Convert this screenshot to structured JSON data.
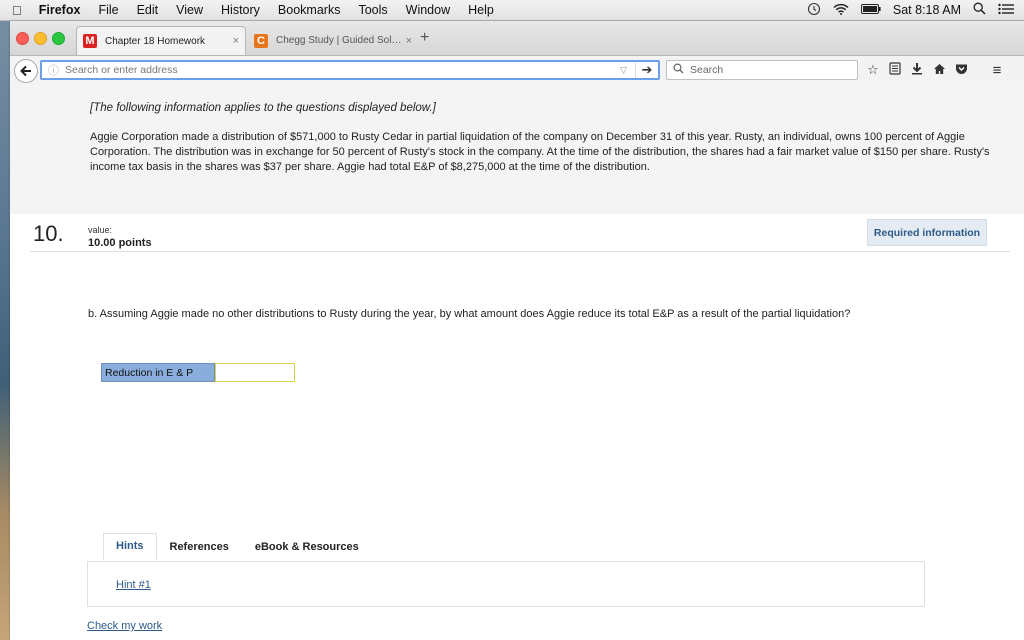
{
  "menubar": {
    "app": "Firefox",
    "items": [
      "File",
      "Edit",
      "View",
      "History",
      "Bookmarks",
      "Tools",
      "Window",
      "Help"
    ],
    "clock": "Sat 8:18 AM"
  },
  "tabs": [
    {
      "favicon": "M",
      "title": "Chapter 18 Homework",
      "close": "×"
    },
    {
      "favicon": "C",
      "title": "Chegg Study | Guided Solut...",
      "close": "×"
    }
  ],
  "newtab": "+",
  "nav": {
    "url_placeholder": "Search or enter address",
    "search_placeholder": "Search"
  },
  "info": {
    "intro": "[The following information applies to the questions displayed below.]",
    "body": "Aggie Corporation made a distribution of $571,000 to Rusty Cedar in partial liquidation of the company on December 31 of this year. Rusty, an individual, owns 100 percent of Aggie Corporation. The distribution was in exchange for 50 percent of Rusty's stock in the company. At the time of the distribution, the shares had a fair market value of $150 per share. Rusty's income tax basis in the shares was $37 per share. Aggie had total E&P of $8,275,000 at the time of the distribution."
  },
  "question": {
    "number": "10.",
    "value_label": "value:",
    "points": "10.00 points",
    "required_button": "Required information",
    "text": "b. Assuming Aggie made no other distributions to Rusty during the year, by what amount does Aggie reduce its total E&P as a result of the partial liquidation?",
    "answer_label": "Reduction in E & P",
    "answer_value": ""
  },
  "resources": {
    "tabs": [
      "Hints",
      "References",
      "eBook & Resources"
    ],
    "hint_link": "Hint #1",
    "check_link": "Check my work"
  },
  "colors": {
    "link": "#2d5a88",
    "answer_label_bg": "#8aaedb",
    "answer_input_border": "#d9d447",
    "url_focus": "#6d9ee6"
  }
}
